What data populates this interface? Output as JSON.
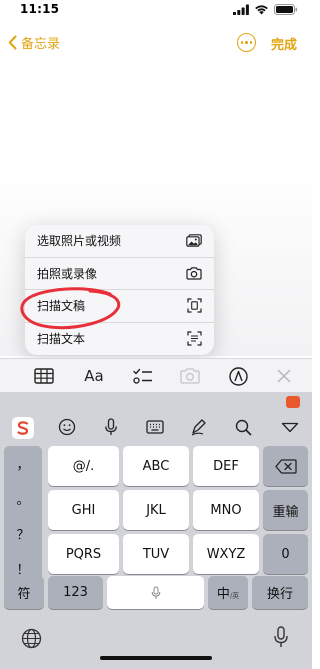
{
  "status_bar": {
    "time": "11:15"
  },
  "nav": {
    "back_label": "备忘录",
    "done_label": "完成"
  },
  "menu": {
    "items": [
      {
        "label": "选取照片或视频",
        "icon": "photo-library-icon"
      },
      {
        "label": "拍照或录像",
        "icon": "camera-icon"
      },
      {
        "label": "扫描文稿",
        "icon": "scan-document-icon"
      },
      {
        "label": "扫描文本",
        "icon": "scan-text-icon"
      }
    ]
  },
  "format_toolbar": {
    "format_label": "Aa",
    "icons": [
      "table-icon",
      "format-text-icon",
      "checklist-icon",
      "camera-icon",
      "markup-pen-icon",
      "close-icon"
    ]
  },
  "keyboard": {
    "punctuation": [
      "，",
      "。",
      "？",
      "！"
    ],
    "keys": [
      "@/.",
      "ABC",
      "DEF",
      "GHI",
      "JKL",
      "MNO",
      "PQRS",
      "TUV",
      "WXYZ"
    ],
    "reinput_label": "重输",
    "zero_label": "0",
    "symbol_label": "符",
    "numbers_label": "123",
    "lang_label": "中",
    "lang_sub_label": "/英",
    "return_label": "换行"
  },
  "colors": {
    "accent": "#e2a511",
    "annotation": "#e8303a",
    "keyboard_bg": "#d1d3d9"
  }
}
